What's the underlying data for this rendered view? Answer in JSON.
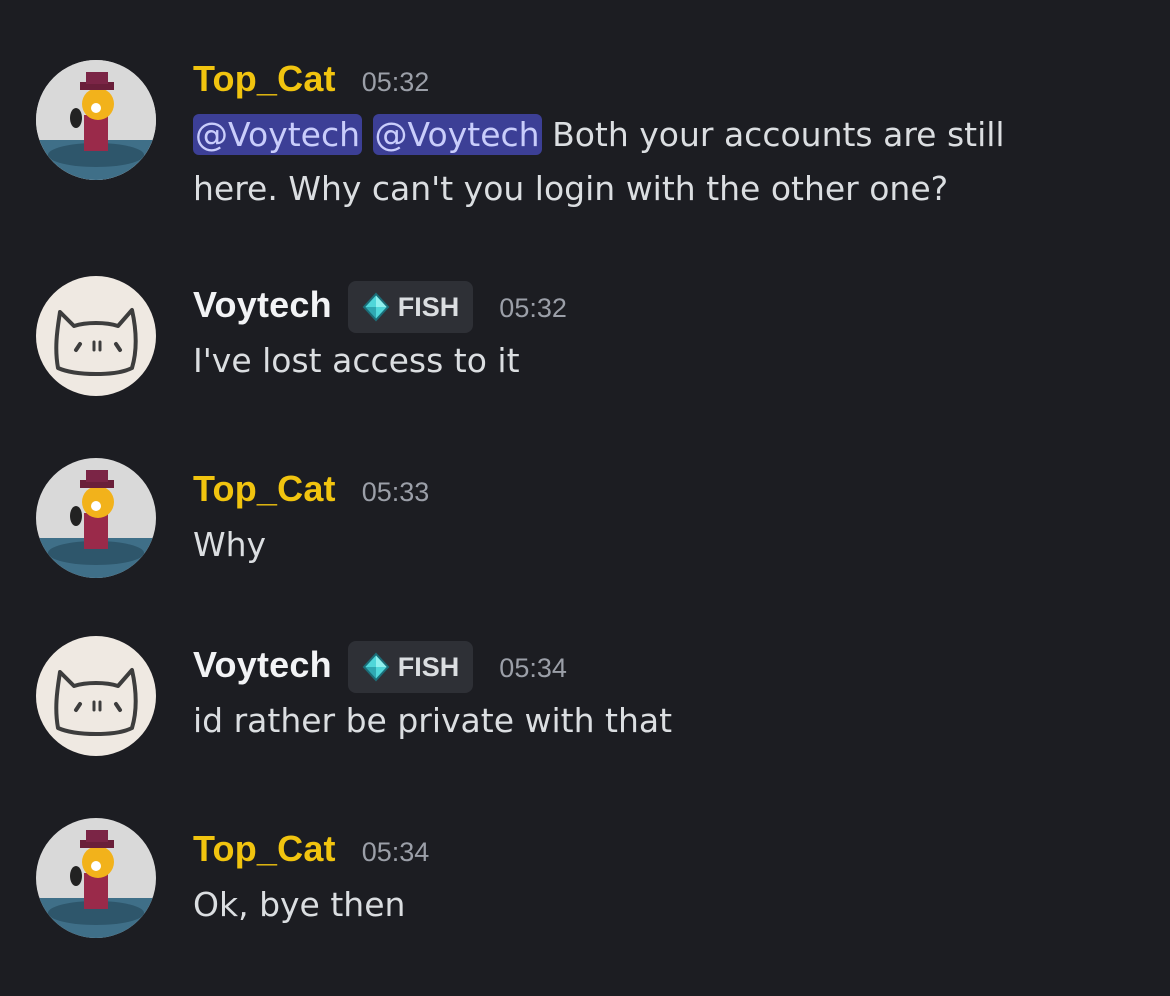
{
  "messages": [
    {
      "author": "Top_Cat",
      "author_color": "#f1c40f",
      "timestamp": "05:32",
      "avatar_icon": "top-cat-avatar",
      "mentions": [
        "@Voytech",
        "@Voytech"
      ],
      "text_line1": "Both your accounts are still",
      "text_line2": "here. Why can't you login with the other one?"
    },
    {
      "author": "Voytech",
      "author_color": "#f2f3f5",
      "tag": {
        "icon": "diamond-icon",
        "label": "FISH"
      },
      "timestamp": "05:32",
      "avatar_icon": "cat-face-avatar",
      "text": "I've lost access to it"
    },
    {
      "author": "Top_Cat",
      "author_color": "#f1c40f",
      "timestamp": "05:33",
      "avatar_icon": "top-cat-avatar",
      "text": "Why"
    },
    {
      "author": "Voytech",
      "author_color": "#f2f3f5",
      "tag": {
        "icon": "diamond-icon",
        "label": "FISH"
      },
      "timestamp": "05:34",
      "avatar_icon": "cat-face-avatar",
      "text": "id rather be private with that"
    },
    {
      "author": "Top_Cat",
      "author_color": "#f1c40f",
      "timestamp": "05:34",
      "avatar_icon": "top-cat-avatar",
      "text": "Ok, bye then"
    }
  ],
  "colors": {
    "background": "#1c1d22",
    "mention_bg": "#3c3f96",
    "mention_text": "#c9cdfb",
    "tag_bg": "#2e3036"
  }
}
